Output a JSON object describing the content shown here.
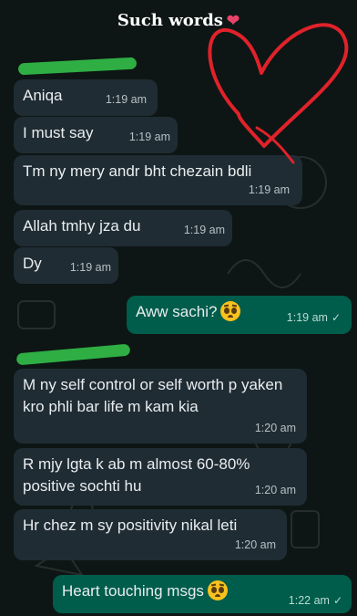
{
  "header": {
    "title": "Such words",
    "heart_icon": "❤"
  },
  "messages": [
    {
      "text": "Aniqa",
      "time": "1:19 am"
    },
    {
      "text": "I must say",
      "time": "1:19 am"
    },
    {
      "text": "Tm ny mery andr bht chezain bdli",
      "time": "1:19 am"
    },
    {
      "text": "Allah tmhy jza du",
      "time": "1:19 am"
    },
    {
      "text": "Dy",
      "time": "1:19 am"
    },
    {
      "text": "Aww sachi?",
      "time": "1:19 am",
      "tick": "✓"
    },
    {
      "text": "M ny self control or self worth p yaken kro phli bar life m kam kia",
      "time": "1:20 am"
    },
    {
      "text": "R mjy lgta k ab m almost 60-80% positive sochti hu",
      "time": "1:20 am"
    },
    {
      "text": "Hr chez m sy positivity nikal leti",
      "time": "1:20 am"
    },
    {
      "text": "Heart touching msgs",
      "time": "1:22 am",
      "tick": "✓"
    }
  ],
  "colors": {
    "incoming": "#1f2c34",
    "outgoing": "#005c4b",
    "scribble": "#e0222b",
    "redaction": "#2fae44"
  }
}
